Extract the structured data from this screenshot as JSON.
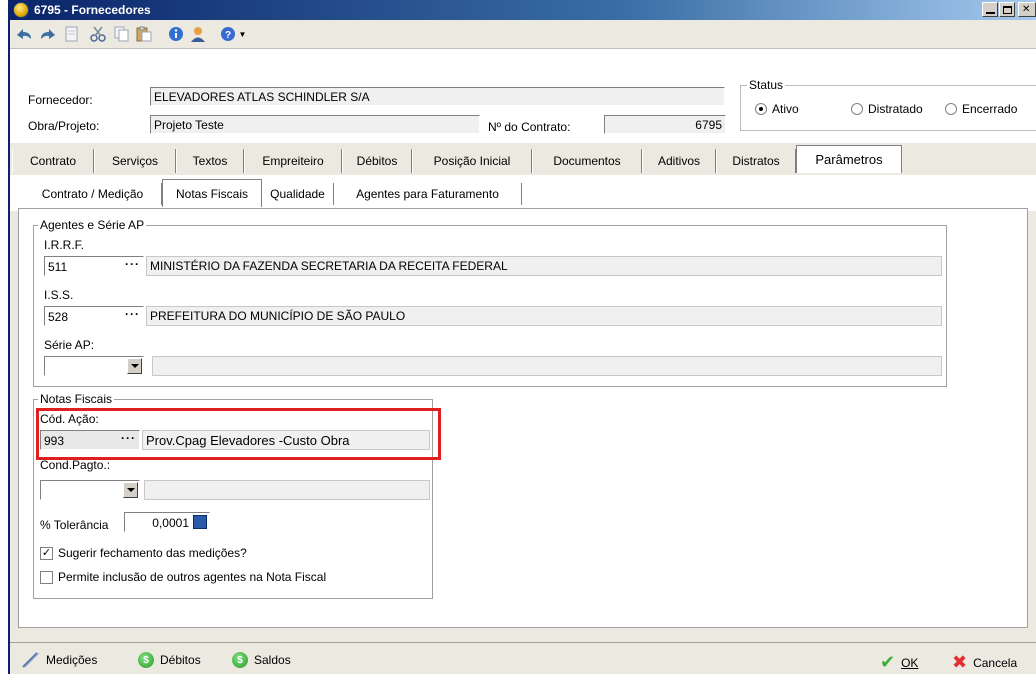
{
  "window": {
    "title": "6795 - Fornecedores"
  },
  "header": {
    "fornecedor_label": "Fornecedor:",
    "fornecedor_value": "ELEVADORES ATLAS SCHINDLER S/A",
    "obra_label": "Obra/Projeto:",
    "obra_value": "Projeto Teste",
    "contrato_label": "Nº do Contrato:",
    "contrato_value": "6795",
    "status": {
      "legend": "Status",
      "options": [
        "Ativo",
        "Distratado",
        "Encerrado"
      ],
      "selected": "Ativo"
    }
  },
  "tabs": [
    "Contrato",
    "Serviços",
    "Textos",
    "Empreiteiro",
    "Débitos",
    "Posição Inicial",
    "Documentos",
    "Aditivos",
    "Distratos",
    "Parâmetros"
  ],
  "active_tab": "Parâmetros",
  "subtabs": [
    "Contrato / Medição",
    "Notas Fiscais",
    "Qualidade",
    "Agentes para Faturamento"
  ],
  "active_subtab": "Notas Fiscais",
  "agentes": {
    "legend": "Agentes e Série AP",
    "irrf_label": "I.R.R.F.",
    "irrf_code": "511",
    "irrf_desc": "MINISTÉRIO DA FAZENDA SECRETARIA DA RECEITA FEDERAL",
    "iss_label": "I.S.S.",
    "iss_code": "528",
    "iss_desc": "PREFEITURA DO MUNICÍPIO DE SÃO PAULO",
    "serie_label": "Série AP:",
    "serie_value": ""
  },
  "notas": {
    "legend": "Notas Fiscais",
    "cod_acao_label": "Cód. Ação:",
    "cod_acao_code": "993",
    "cod_acao_desc": "Prov.Cpag Elevadores -Custo Obra",
    "cond_pagto_label": "Cond.Pagto.:",
    "cond_pagto_value": "",
    "tolerancia_label": "% Tolerância",
    "tolerancia_value": "0,0001",
    "sugerir_label": "Sugerir fechamento das medições?",
    "sugerir_checked": true,
    "permite_label": "Permite inclusão de outros agentes na Nota Fiscal",
    "permite_checked": false
  },
  "bottom": {
    "medicoes": "Medições",
    "debitos": "Débitos",
    "saldos": "Saldos",
    "ok": "OK",
    "cancelar": "Cancela"
  },
  "colors": {
    "title_bar": "#0a246a",
    "highlight": "#e02020",
    "ok_icon": "#3cb03c",
    "cancel_icon": "#e03030"
  }
}
